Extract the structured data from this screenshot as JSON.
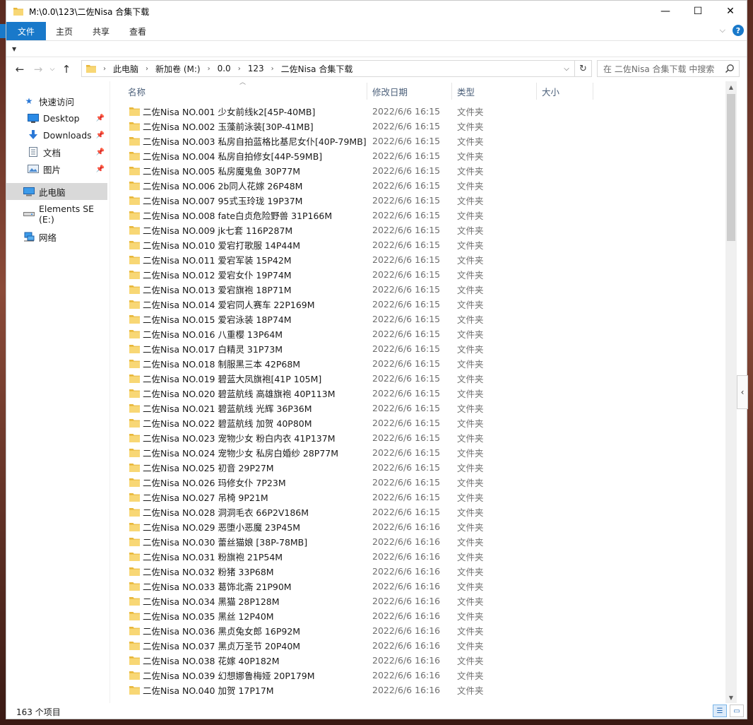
{
  "window": {
    "title": "M:\\0.0\\123\\二佐Nisa 合集下载",
    "minimize": "—",
    "maximize": "☐",
    "close": "✕"
  },
  "ribbon": {
    "tabs": [
      "文件",
      "主页",
      "共享",
      "查看"
    ],
    "help": "?"
  },
  "address": {
    "crumbs": [
      "此电脑",
      "新加卷 (M:)",
      "0.0",
      "123",
      "二佐Nisa 合集下载"
    ],
    "search_placeholder": "在 二佐Nisa 合集下载 中搜索"
  },
  "nav": {
    "quick_access": "快速访问",
    "items": [
      {
        "label": "Desktop",
        "icon": "desktop-icon",
        "pinned": true
      },
      {
        "label": "Downloads",
        "icon": "download-icon",
        "pinned": true
      },
      {
        "label": "文档",
        "icon": "document-icon",
        "pinned": true
      },
      {
        "label": "图片",
        "icon": "picture-icon",
        "pinned": true
      }
    ],
    "this_pc": "此电脑",
    "drive": "Elements SE (E:)",
    "network": "网络"
  },
  "columns": {
    "name": "名称",
    "date": "修改日期",
    "type": "类型",
    "size": "大小"
  },
  "files": [
    {
      "name": "二佐Nisa NO.001 少女前线k2[45P-40MB]",
      "date": "2022/6/6 16:15",
      "type": "文件夹"
    },
    {
      "name": "二佐Nisa NO.002 玉藻前泳装[30P-41MB]",
      "date": "2022/6/6 16:15",
      "type": "文件夹"
    },
    {
      "name": "二佐Nisa NO.003 私房自拍蓝格比基尼女仆[40P-79MB]",
      "date": "2022/6/6 16:15",
      "type": "文件夹"
    },
    {
      "name": "二佐Nisa NO.004 私房自拍修女[44P-59MB]",
      "date": "2022/6/6 16:15",
      "type": "文件夹"
    },
    {
      "name": "二佐Nisa NO.005 私房魔鬼鱼 30P77M",
      "date": "2022/6/6 16:15",
      "type": "文件夹"
    },
    {
      "name": "二佐Nisa NO.006 2b同人花嫁 26P48M",
      "date": "2022/6/6 16:15",
      "type": "文件夹"
    },
    {
      "name": "二佐Nisa NO.007 95式玉玲珑 19P37M",
      "date": "2022/6/6 16:15",
      "type": "文件夹"
    },
    {
      "name": "二佐Nisa NO.008 fate白贞危险野兽 31P166M",
      "date": "2022/6/6 16:15",
      "type": "文件夹"
    },
    {
      "name": "二佐Nisa NO.009 jk七套 116P287M",
      "date": "2022/6/6 16:15",
      "type": "文件夹"
    },
    {
      "name": "二佐Nisa NO.010 爱宕打歌服 14P44M",
      "date": "2022/6/6 16:15",
      "type": "文件夹"
    },
    {
      "name": "二佐Nisa NO.011 爱宕军装 15P42M",
      "date": "2022/6/6 16:15",
      "type": "文件夹"
    },
    {
      "name": "二佐Nisa NO.012 爱宕女仆 19P74M",
      "date": "2022/6/6 16:15",
      "type": "文件夹"
    },
    {
      "name": "二佐Nisa NO.013 爱宕旗袍 18P71M",
      "date": "2022/6/6 16:15",
      "type": "文件夹"
    },
    {
      "name": "二佐Nisa NO.014 爱宕同人赛车 22P169M",
      "date": "2022/6/6 16:15",
      "type": "文件夹"
    },
    {
      "name": "二佐Nisa NO.015 爱宕泳装 18P74M",
      "date": "2022/6/6 16:15",
      "type": "文件夹"
    },
    {
      "name": "二佐Nisa NO.016 八重樱 13P64M",
      "date": "2022/6/6 16:15",
      "type": "文件夹"
    },
    {
      "name": "二佐Nisa NO.017 白精灵 31P73M",
      "date": "2022/6/6 16:15",
      "type": "文件夹"
    },
    {
      "name": "二佐Nisa NO.018 制服黑三本 42P68M",
      "date": "2022/6/6 16:15",
      "type": "文件夹"
    },
    {
      "name": "二佐Nisa NO.019 碧蓝大凤旗袍[41P 105M]",
      "date": "2022/6/6 16:15",
      "type": "文件夹"
    },
    {
      "name": "二佐Nisa NO.020 碧蓝航线 高雄旗袍 40P113M",
      "date": "2022/6/6 16:15",
      "type": "文件夹"
    },
    {
      "name": "二佐Nisa NO.021 碧蓝航线 光辉 36P36M",
      "date": "2022/6/6 16:15",
      "type": "文件夹"
    },
    {
      "name": "二佐Nisa NO.022 碧蓝航线 加贺 40P80M",
      "date": "2022/6/6 16:15",
      "type": "文件夹"
    },
    {
      "name": "二佐Nisa NO.023 宠物少女 粉白内衣 41P137M",
      "date": "2022/6/6 16:15",
      "type": "文件夹"
    },
    {
      "name": "二佐Nisa NO.024 宠物少女 私房白婚纱 28P77M",
      "date": "2022/6/6 16:15",
      "type": "文件夹"
    },
    {
      "name": "二佐Nisa NO.025 初音 29P27M",
      "date": "2022/6/6 16:15",
      "type": "文件夹"
    },
    {
      "name": "二佐Nisa NO.026 玛修女仆 7P23M",
      "date": "2022/6/6 16:15",
      "type": "文件夹"
    },
    {
      "name": "二佐Nisa NO.027 吊椅 9P21M",
      "date": "2022/6/6 16:15",
      "type": "文件夹"
    },
    {
      "name": "二佐Nisa NO.028 洞洞毛衣 66P2V186M",
      "date": "2022/6/6 16:15",
      "type": "文件夹"
    },
    {
      "name": "二佐Nisa NO.029 恶堕小恶魔 23P45M",
      "date": "2022/6/6 16:16",
      "type": "文件夹"
    },
    {
      "name": "二佐Nisa NO.030 蕾丝猫娘 [38P-78MB]",
      "date": "2022/6/6 16:16",
      "type": "文件夹"
    },
    {
      "name": "二佐Nisa NO.031 粉旗袍 21P54M",
      "date": "2022/6/6 16:16",
      "type": "文件夹"
    },
    {
      "name": "二佐Nisa NO.032 粉猪 33P68M",
      "date": "2022/6/6 16:16",
      "type": "文件夹"
    },
    {
      "name": "二佐Nisa NO.033 葛饰北斋 21P90M",
      "date": "2022/6/6 16:16",
      "type": "文件夹"
    },
    {
      "name": "二佐Nisa NO.034 黑猫 28P128M",
      "date": "2022/6/6 16:16",
      "type": "文件夹"
    },
    {
      "name": "二佐Nisa NO.035 黑丝 12P40M",
      "date": "2022/6/6 16:16",
      "type": "文件夹"
    },
    {
      "name": "二佐Nisa NO.036 黑贞兔女郎 16P92M",
      "date": "2022/6/6 16:16",
      "type": "文件夹"
    },
    {
      "name": "二佐Nisa NO.037 黑贞万圣节 20P40M",
      "date": "2022/6/6 16:16",
      "type": "文件夹"
    },
    {
      "name": "二佐Nisa NO.038 花嫁 40P182M",
      "date": "2022/6/6 16:16",
      "type": "文件夹"
    },
    {
      "name": "二佐Nisa NO.039 幻想娜鲁梅娅 20P179M",
      "date": "2022/6/6 16:16",
      "type": "文件夹"
    },
    {
      "name": "二佐Nisa NO.040 加贺 17P17M",
      "date": "2022/6/6 16:16",
      "type": "文件夹"
    }
  ],
  "status": {
    "count": "163 个项目"
  },
  "colors": {
    "accent": "#1979ca",
    "folder": "#f8d775",
    "folder_dark": "#e8b73a",
    "header_text": "#4c607a"
  }
}
